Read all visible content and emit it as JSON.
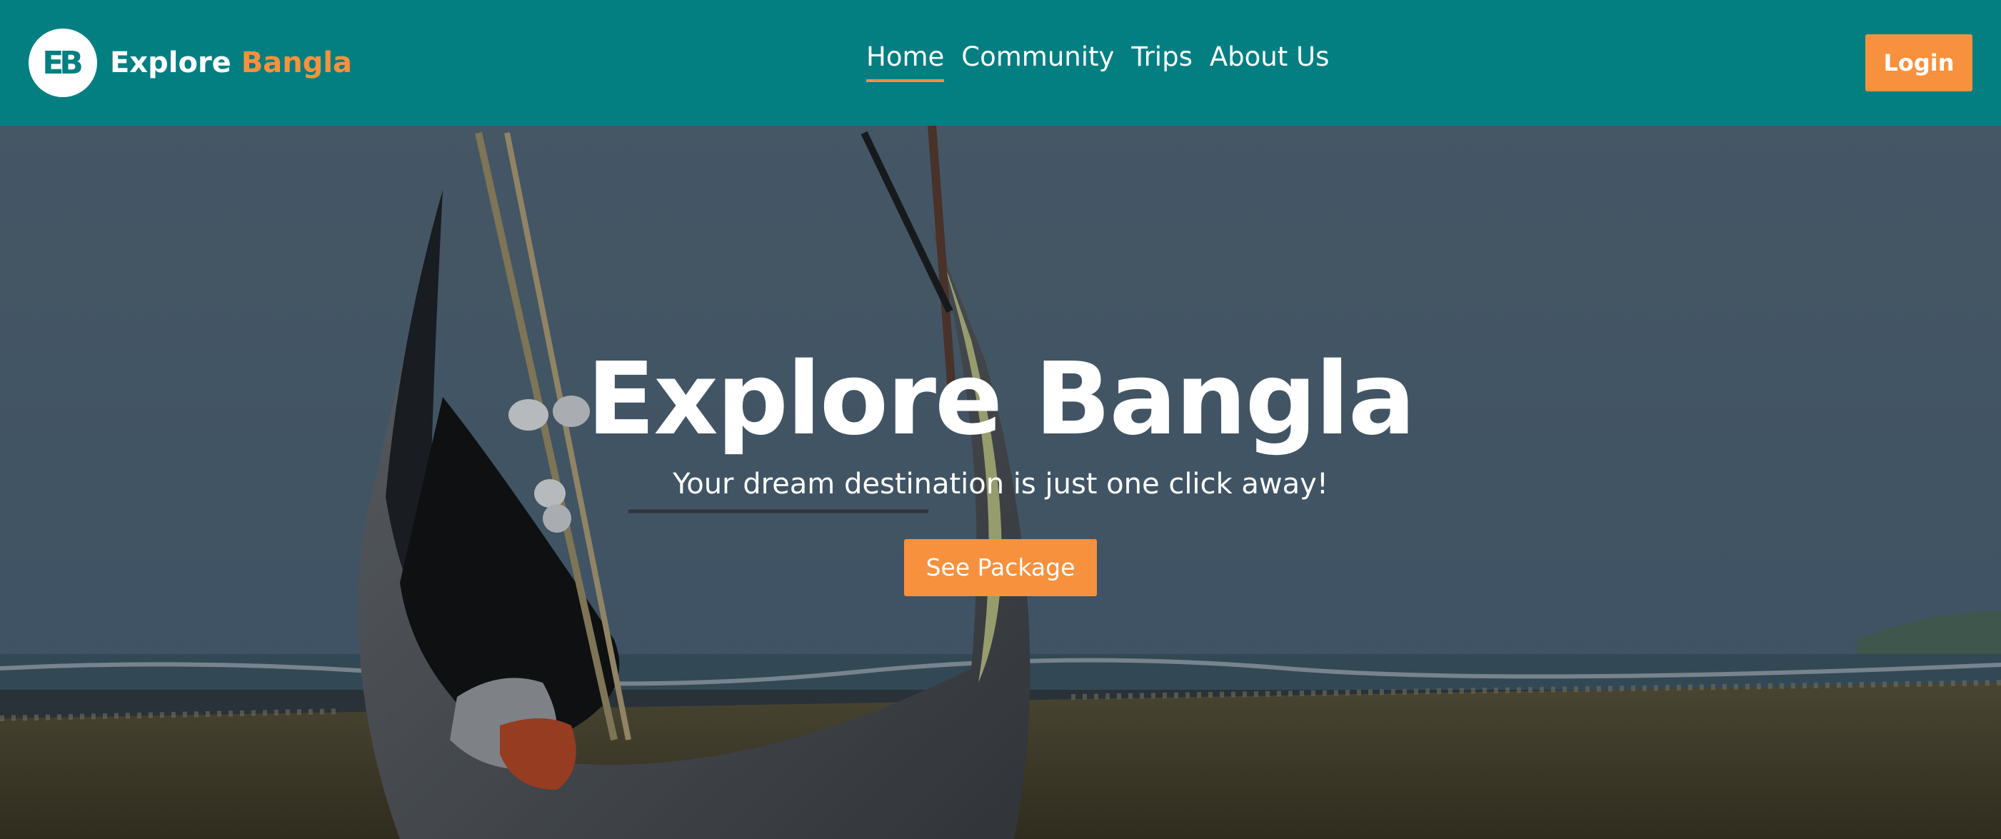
{
  "brand": {
    "logo_text": "EB",
    "name_primary": "Explore",
    "name_accent": "Bangla"
  },
  "nav": {
    "items": [
      {
        "label": "Home",
        "active": true
      },
      {
        "label": "Community",
        "active": false
      },
      {
        "label": "Trips",
        "active": false
      },
      {
        "label": "About Us",
        "active": false
      }
    ],
    "login_label": "Login"
  },
  "hero": {
    "title": "Explore Bangla",
    "subtitle": "Your dream destination is just one click away!",
    "cta_label": "See Package"
  },
  "colors": {
    "primary": "#037f82",
    "accent": "#f7913d",
    "text": "#ffffff"
  }
}
